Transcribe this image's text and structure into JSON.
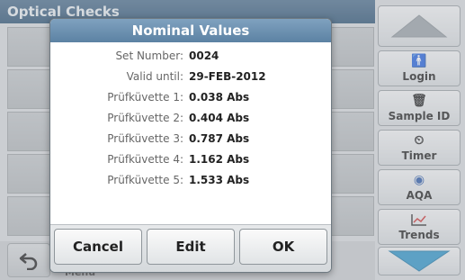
{
  "background": {
    "title": "Optical Checks",
    "menu_label": "Menu"
  },
  "sidebar": {
    "scroll_up_label": "",
    "items": [
      {
        "label": "Login",
        "icon": "person-icon"
      },
      {
        "label": "Sample ID",
        "icon": "sample-bottle-icon"
      },
      {
        "label": "Timer",
        "icon": "timer-icon"
      },
      {
        "label": "AQA",
        "icon": "aqa-icon"
      },
      {
        "label": "Trends",
        "icon": "trends-chart-icon"
      }
    ]
  },
  "dialog": {
    "title": "Nominal Values",
    "rows": [
      {
        "label": "Set Number:",
        "value": "0024"
      },
      {
        "label": "Valid until:",
        "value": "29-FEB-2012"
      },
      {
        "label": "Prüfküvette 1:",
        "value": "0.038 Abs"
      },
      {
        "label": "Prüfküvette 2:",
        "value": "0.404 Abs"
      },
      {
        "label": "Prüfküvette 3:",
        "value": "0.787 Abs"
      },
      {
        "label": "Prüfküvette 4:",
        "value": "1.162 Abs"
      },
      {
        "label": "Prüfküvette 5:",
        "value": "1.533 Abs"
      }
    ],
    "buttons": {
      "cancel": "Cancel",
      "edit": "Edit",
      "ok": "OK"
    }
  },
  "colors": {
    "title_bar": "#5c82a3",
    "scroll_arrow": "#2f95c9"
  }
}
